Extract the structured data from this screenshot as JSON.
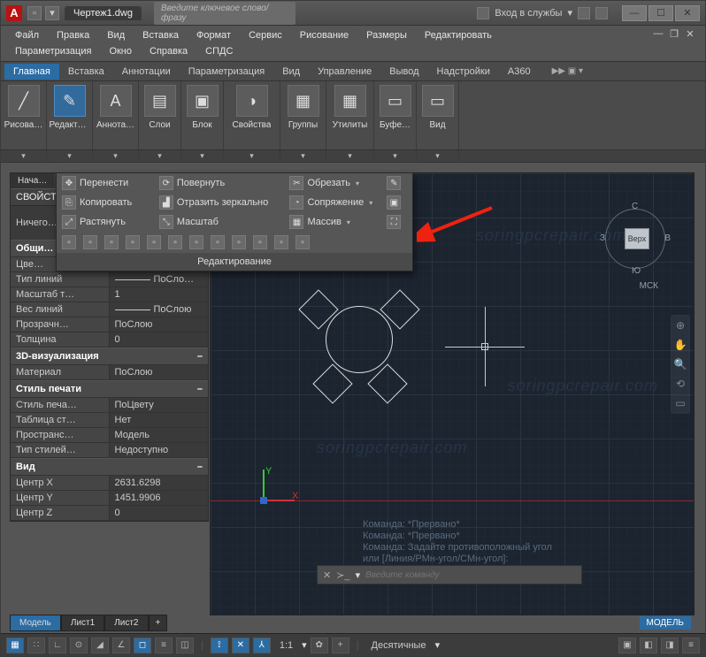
{
  "title": {
    "file": "Чертеж1.dwg",
    "search_placeholder": "Введите ключевое слово/фразу",
    "signin": "Вход в службы"
  },
  "menu": [
    "Файл",
    "Правка",
    "Вид",
    "Вставка",
    "Формат",
    "Сервис",
    "Рисование",
    "Размеры",
    "Редактировать"
  ],
  "menu2": [
    "Параметризация",
    "Окно",
    "Справка",
    "СПДС"
  ],
  "ribbon_tabs": [
    "Главная",
    "Вставка",
    "Аннотации",
    "Параметризация",
    "Вид",
    "Управление",
    "Вывод",
    "Надстройки",
    "A360"
  ],
  "ribbon_extras": "▶▶ ▣ ▾",
  "panels": [
    {
      "label": "Рисова…",
      "glyph": "╱"
    },
    {
      "label": "Редакти…",
      "glyph": "✎",
      "selected": true
    },
    {
      "label": "Аннота…",
      "glyph": "A"
    },
    {
      "label": "Слои",
      "glyph": "▤"
    },
    {
      "label": "Блок",
      "glyph": "▣"
    },
    {
      "label": "Свойства",
      "glyph": "◑"
    },
    {
      "label": "Группы",
      "glyph": "▦"
    },
    {
      "label": "Утилиты",
      "glyph": "▦"
    },
    {
      "label": "Буфе…",
      "glyph": "▭"
    },
    {
      "label": "Вид",
      "glyph": "▭"
    }
  ],
  "flyout": {
    "rows": [
      [
        {
          "icon": "✥",
          "label": "Перенести"
        },
        {
          "icon": "⟳",
          "label": "Повернуть"
        },
        {
          "icon": "✂",
          "label": "Обрезать",
          "dd": true
        },
        {
          "icon": "✎",
          "label": ""
        }
      ],
      [
        {
          "icon": "⎘",
          "label": "Копировать"
        },
        {
          "icon": "▟",
          "label": "Отразить зеркально"
        },
        {
          "icon": "◔",
          "label": "Сопряжение",
          "dd": true
        },
        {
          "icon": "▣",
          "label": ""
        }
      ],
      [
        {
          "icon": "⤢",
          "label": "Растянуть"
        },
        {
          "icon": "⤡",
          "label": "Масштаб"
        },
        {
          "icon": "▦",
          "label": "Массив",
          "dd": true
        },
        {
          "icon": "⛶",
          "label": ""
        }
      ]
    ],
    "title": "Редактирование"
  },
  "dock": {
    "start_tab": "Нача…",
    "header": "СВОЙСТ…",
    "selection": "Ничего…",
    "groups": [
      {
        "title": "Общи…",
        "rows": [
          {
            "k": "Цве…",
            "v": ""
          },
          {
            "k": "Тип линий",
            "v": "ПоСло…",
            "line": true
          },
          {
            "k": "Масштаб т…",
            "v": "1"
          },
          {
            "k": "Вес линий",
            "v": "ПоСлою",
            "line": true
          },
          {
            "k": "Прозрачн…",
            "v": "ПоСлою"
          },
          {
            "k": "Толщина",
            "v": "0"
          }
        ]
      },
      {
        "title": "3D-визуализация",
        "rows": [
          {
            "k": "Материал",
            "v": "ПоСлою"
          }
        ]
      },
      {
        "title": "Стиль печати",
        "rows": [
          {
            "k": "Стиль печа…",
            "v": "ПоЦвету"
          },
          {
            "k": "Таблица ст…",
            "v": "Нет"
          },
          {
            "k": "Пространс…",
            "v": "Модель"
          },
          {
            "k": "Тип стилей…",
            "v": "Недоступно"
          }
        ]
      },
      {
        "title": "Вид",
        "rows": [
          {
            "k": "Центр X",
            "v": "2631.6298"
          },
          {
            "k": "Центр Y",
            "v": "1451.9906"
          },
          {
            "k": "Центр Z",
            "v": "0"
          }
        ]
      }
    ]
  },
  "viewcube": {
    "n": "С",
    "s": "Ю",
    "e": "В",
    "w": "З",
    "face": "Верх",
    "label": "МСК"
  },
  "cmd_history": [
    "Команда: *Прервано*",
    "Команда: *Прервано*",
    "Команда: Задайте противоположный угол",
    "или [Линия/РМн-угол/СМн-угол]:"
  ],
  "cmd_placeholder": "Введите команду",
  "model_tabs": [
    "Модель",
    "Лист1",
    "Лист2"
  ],
  "model_badge": "МОДЕЛЬ",
  "status": {
    "scale": "1:1",
    "units": "Десятичные"
  }
}
